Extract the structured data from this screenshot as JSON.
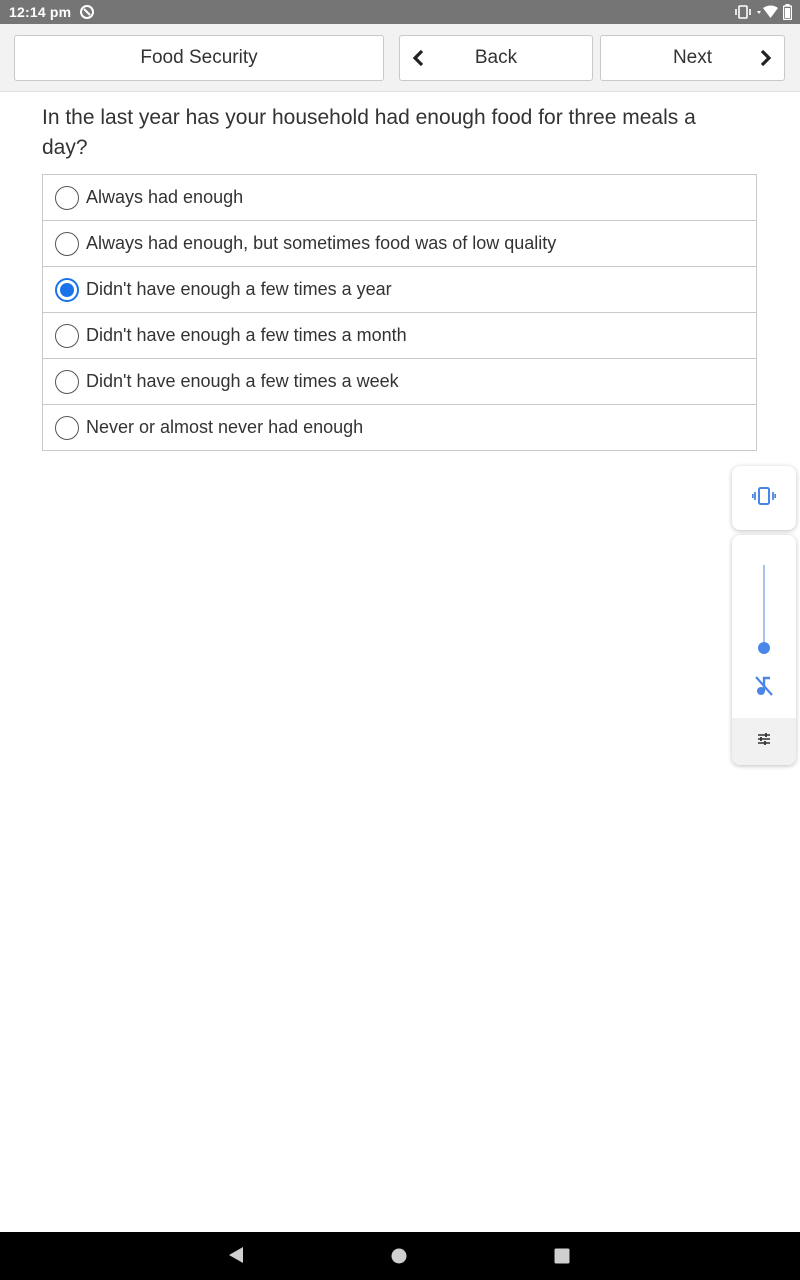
{
  "status_bar": {
    "time": "12:14 pm"
  },
  "toolbar": {
    "title": "Food Security",
    "back_label": "Back",
    "next_label": "Next"
  },
  "question": {
    "text": "In the last year has your household had enough food for three meals a day?",
    "options": [
      {
        "label": "Always had enough",
        "selected": false
      },
      {
        "label": "Always had enough, but sometimes food was of low quality",
        "selected": false
      },
      {
        "label": "Didn't have enough a few times a year",
        "selected": true
      },
      {
        "label": "Didn't have enough a few times a month",
        "selected": false
      },
      {
        "label": "Didn't have enough a few times a week",
        "selected": false
      },
      {
        "label": "Never or almost never had enough",
        "selected": false
      }
    ]
  },
  "colors": {
    "accent": "#1a73e8",
    "status_bar": "#757575",
    "toolbar": "#f2f2f2"
  },
  "icons": [
    "sync-icon",
    "vibrate-icon",
    "wifi-icon",
    "battery-icon",
    "chevron-left-icon",
    "chevron-right-icon",
    "mute-icon",
    "tune-icon",
    "back-triangle-icon",
    "home-circle-icon",
    "recents-square-icon"
  ]
}
